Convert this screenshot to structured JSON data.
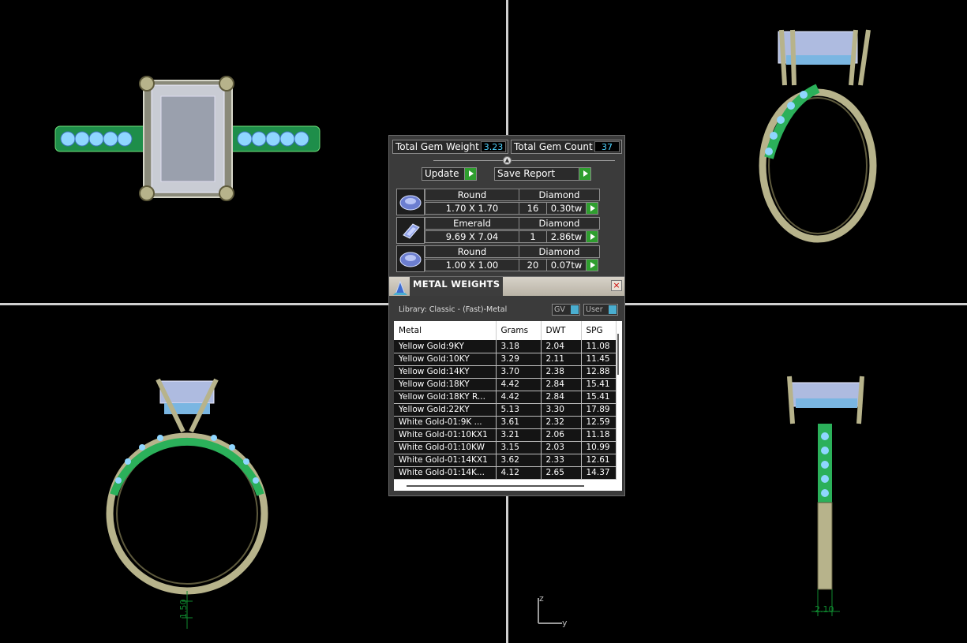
{
  "gem_report": {
    "total_weight_label": "Total Gem Weight",
    "total_weight_value": "3.23",
    "total_count_label": "Total Gem Count",
    "total_count_value": "37",
    "update_label": "Update",
    "save_report_label": "Save Report",
    "rows": [
      {
        "cut": "Round",
        "material": "Diamond",
        "size": "1.70 X 1.70",
        "count": "16",
        "weight": "0.30tw"
      },
      {
        "cut": "Emerald",
        "material": "Diamond",
        "size": "9.69 X 7.04",
        "count": "1",
        "weight": "2.86tw"
      },
      {
        "cut": "Round",
        "material": "Diamond",
        "size": "1.00 X 1.00",
        "count": "20",
        "weight": "0.07tw"
      }
    ]
  },
  "metal_weights": {
    "title": "METAL WEIGHTS",
    "close_symbol": "×",
    "library_label": "Library: Classic - (Fast)-Metal",
    "gv_toggle": "GV",
    "user_toggle": "User",
    "columns": [
      "Metal",
      "Grams",
      "DWT",
      "SPG"
    ],
    "rows": [
      [
        "Yellow Gold:9KY",
        "3.18",
        "2.04",
        "11.08"
      ],
      [
        "Yellow Gold:10KY",
        "3.29",
        "2.11",
        "11.45"
      ],
      [
        "Yellow Gold:14KY",
        "3.70",
        "2.38",
        "12.88"
      ],
      [
        "Yellow Gold:18KY",
        "4.42",
        "2.84",
        "15.41"
      ],
      [
        "Yellow Gold:18KY R...",
        "4.42",
        "2.84",
        "15.41"
      ],
      [
        "Yellow Gold:22KY",
        "5.13",
        "3.30",
        "17.89"
      ],
      [
        "White Gold-01:9K ...",
        "3.61",
        "2.32",
        "12.59"
      ],
      [
        "White Gold-01:10KX1",
        "3.21",
        "2.06",
        "11.18"
      ],
      [
        "White Gold-01:10KW",
        "3.15",
        "2.03",
        "10.99"
      ],
      [
        "White Gold-01:14KX1",
        "3.62",
        "2.33",
        "12.61"
      ],
      [
        "White Gold-01:14K...",
        "4.12",
        "2.65",
        "14.37"
      ]
    ]
  },
  "dimensions": {
    "bottom_left": "1.50",
    "bottom_right": "2.10"
  },
  "axis": {
    "z": "z",
    "y": "y"
  },
  "colors": {
    "metal": "#b7b38b",
    "metal_dark": "#6e6a4a",
    "pave": "#2bb05a",
    "stone": "#aebbe0",
    "accent_cyan": "#4fd3ff",
    "go_green": "#2f9e2f"
  }
}
